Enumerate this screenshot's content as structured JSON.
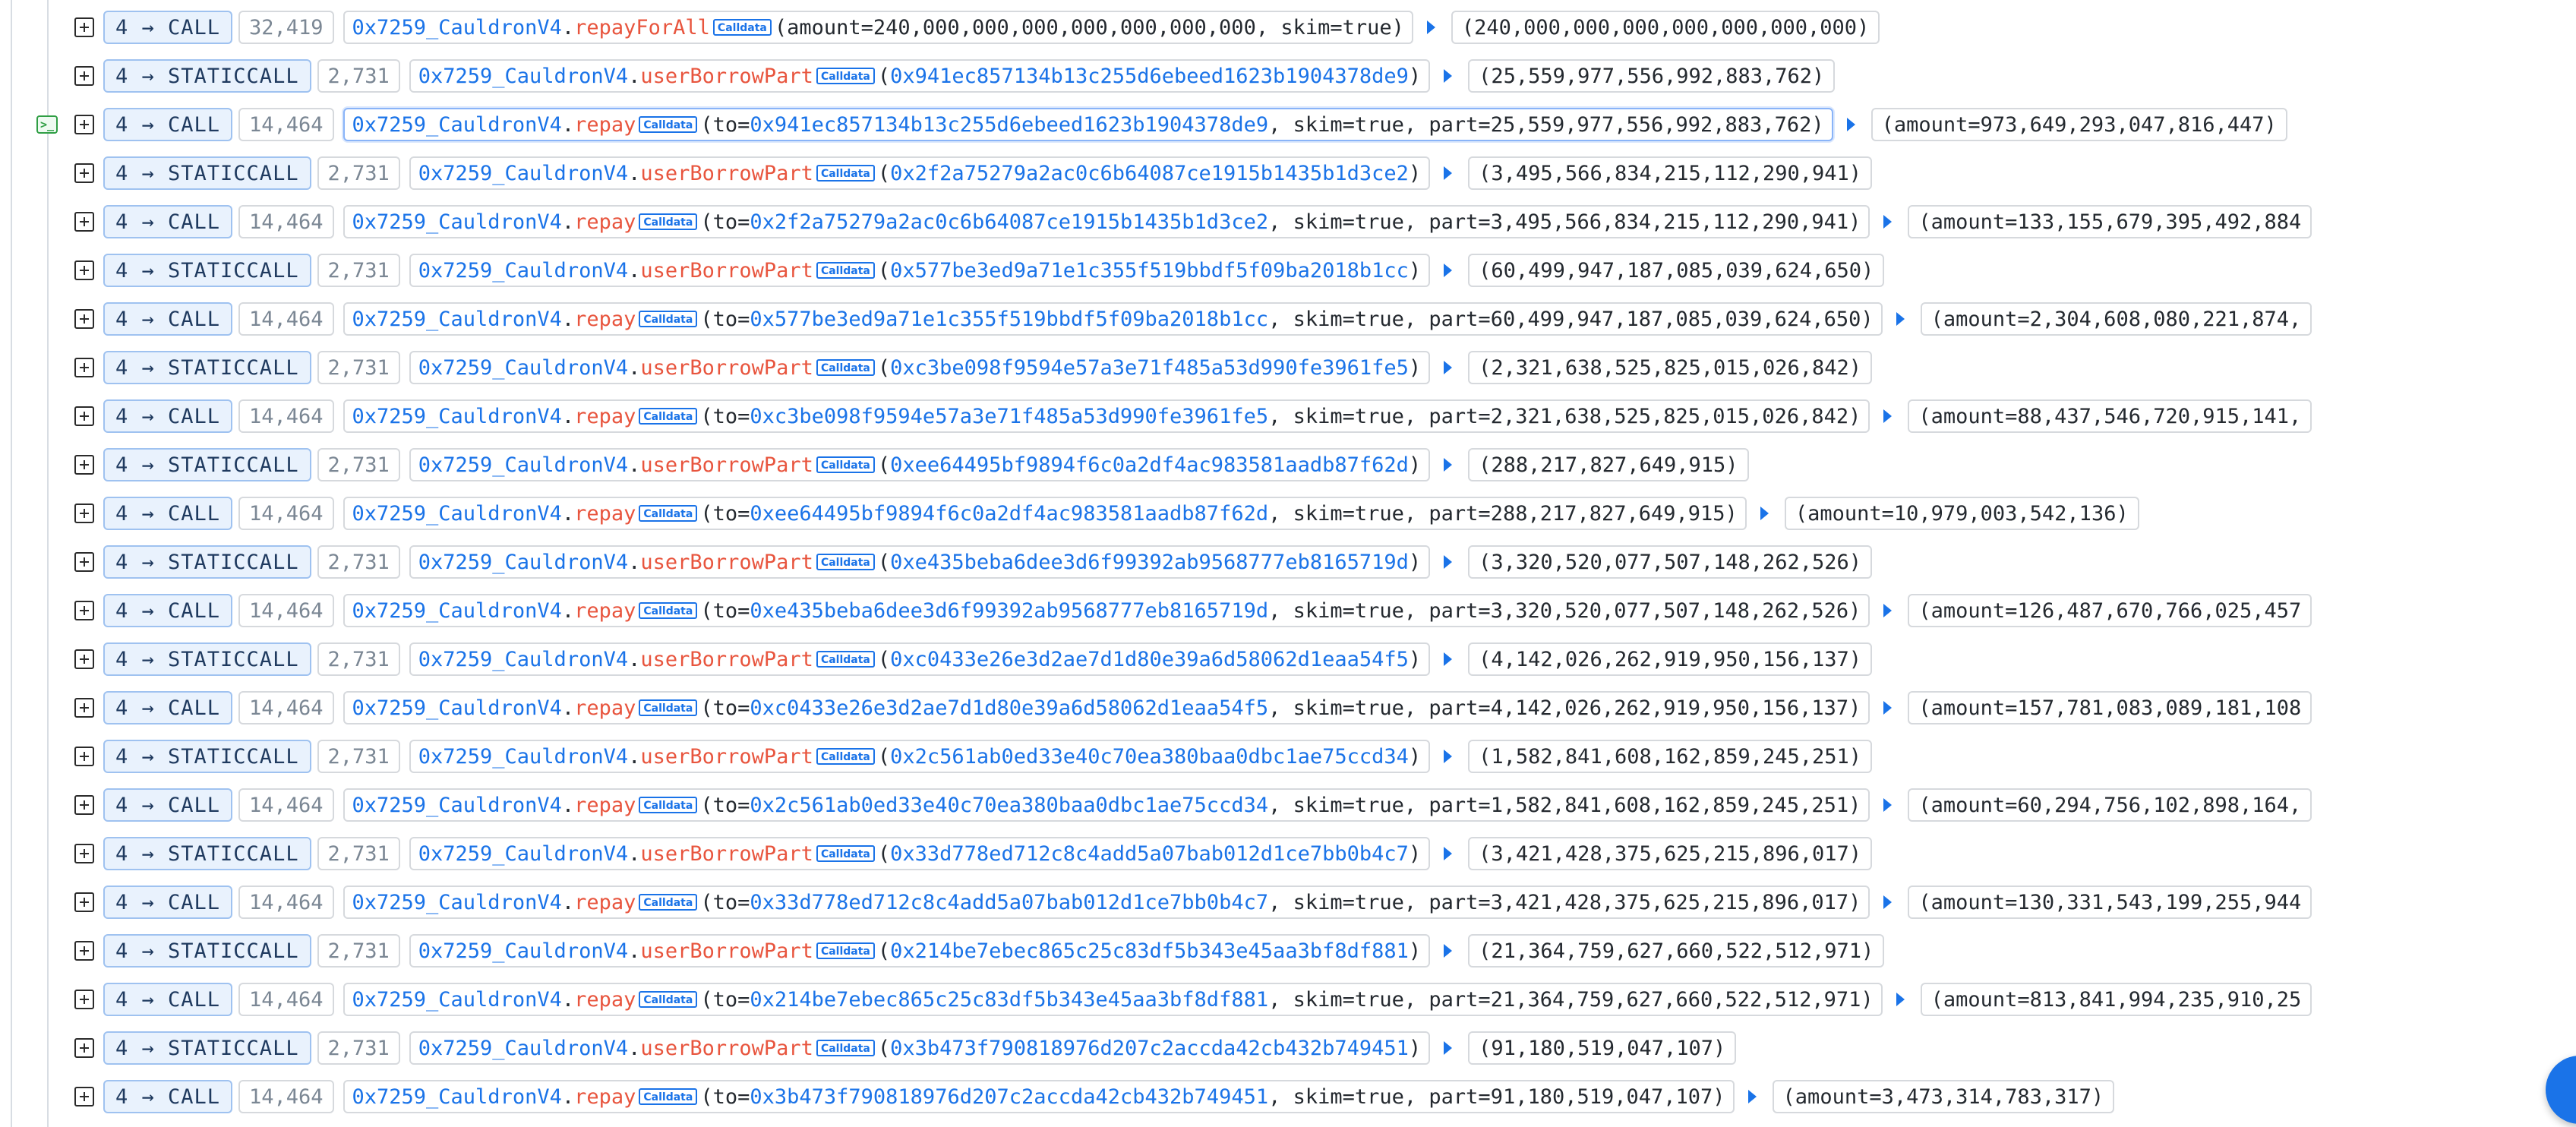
{
  "rows": [
    {
      "depth": "4",
      "type": "CALL",
      "gas": "32,419",
      "contract": "0x7259_CauldronV4",
      "method": "repayForAll",
      "badge": "Calldata",
      "args_pre": "(amount=240,000,000,000,000,000,000,000, skim=true)",
      "addr": "",
      "args_post": "",
      "ret": "(240,000,000,000,000,000,000,000)"
    },
    {
      "depth": "4",
      "type": "STATICCALL",
      "gas": "2,731",
      "contract": "0x7259_CauldronV4",
      "method": "userBorrowPart",
      "badge": "Calldata",
      "args_pre": "(",
      "addr": "0x941ec857134b13c255d6ebeed1623b1904378de9",
      "args_post": ")",
      "ret": "(25,559,977,556,992,883,762)"
    },
    {
      "depth": "4",
      "type": "CALL",
      "gas": "14,464",
      "contract": "0x7259_CauldronV4",
      "method": "repay",
      "badge": "Calldata",
      "args_pre": "(to=",
      "addr": "0x941ec857134b13c255d6ebeed1623b1904378de9",
      "args_post": ", skim=true, part=25,559,977,556,992,883,762)",
      "ret": "(amount=973,649,293,047,816,447)",
      "selected": true
    },
    {
      "depth": "4",
      "type": "STATICCALL",
      "gas": "2,731",
      "contract": "0x7259_CauldronV4",
      "method": "userBorrowPart",
      "badge": "Calldata",
      "args_pre": "(",
      "addr": "0x2f2a75279a2ac0c6b64087ce1915b1435b1d3ce2",
      "args_post": ")",
      "ret": "(3,495,566,834,215,112,290,941)"
    },
    {
      "depth": "4",
      "type": "CALL",
      "gas": "14,464",
      "contract": "0x7259_CauldronV4",
      "method": "repay",
      "badge": "Calldata",
      "args_pre": "(to=",
      "addr": "0x2f2a75279a2ac0c6b64087ce1915b1435b1d3ce2",
      "args_post": ", skim=true, part=3,495,566,834,215,112,290,941)",
      "ret": "(amount=133,155,679,395,492,884"
    },
    {
      "depth": "4",
      "type": "STATICCALL",
      "gas": "2,731",
      "contract": "0x7259_CauldronV4",
      "method": "userBorrowPart",
      "badge": "Calldata",
      "args_pre": "(",
      "addr": "0x577be3ed9a71e1c355f519bbdf5f09ba2018b1cc",
      "args_post": ")",
      "ret": "(60,499,947,187,085,039,624,650)"
    },
    {
      "depth": "4",
      "type": "CALL",
      "gas": "14,464",
      "contract": "0x7259_CauldronV4",
      "method": "repay",
      "badge": "Calldata",
      "args_pre": "(to=",
      "addr": "0x577be3ed9a71e1c355f519bbdf5f09ba2018b1cc",
      "args_post": ", skim=true, part=60,499,947,187,085,039,624,650)",
      "ret": "(amount=2,304,608,080,221,874,"
    },
    {
      "depth": "4",
      "type": "STATICCALL",
      "gas": "2,731",
      "contract": "0x7259_CauldronV4",
      "method": "userBorrowPart",
      "badge": "Calldata",
      "args_pre": "(",
      "addr": "0xc3be098f9594e57a3e71f485a53d990fe3961fe5",
      "args_post": ")",
      "ret": "(2,321,638,525,825,015,026,842)"
    },
    {
      "depth": "4",
      "type": "CALL",
      "gas": "14,464",
      "contract": "0x7259_CauldronV4",
      "method": "repay",
      "badge": "Calldata",
      "args_pre": "(to=",
      "addr": "0xc3be098f9594e57a3e71f485a53d990fe3961fe5",
      "args_post": ", skim=true, part=2,321,638,525,825,015,026,842)",
      "ret": "(amount=88,437,546,720,915,141,"
    },
    {
      "depth": "4",
      "type": "STATICCALL",
      "gas": "2,731",
      "contract": "0x7259_CauldronV4",
      "method": "userBorrowPart",
      "badge": "Calldata",
      "args_pre": "(",
      "addr": "0xee64495bf9894f6c0a2df4ac983581aadb87f62d",
      "args_post": ")",
      "ret": "(288,217,827,649,915)"
    },
    {
      "depth": "4",
      "type": "CALL",
      "gas": "14,464",
      "contract": "0x7259_CauldronV4",
      "method": "repay",
      "badge": "Calldata",
      "args_pre": "(to=",
      "addr": "0xee64495bf9894f6c0a2df4ac983581aadb87f62d",
      "args_post": ", skim=true, part=288,217,827,649,915)",
      "ret": "(amount=10,979,003,542,136)"
    },
    {
      "depth": "4",
      "type": "STATICCALL",
      "gas": "2,731",
      "contract": "0x7259_CauldronV4",
      "method": "userBorrowPart",
      "badge": "Calldata",
      "args_pre": "(",
      "addr": "0xe435beba6dee3d6f99392ab9568777eb8165719d",
      "args_post": ")",
      "ret": "(3,320,520,077,507,148,262,526)"
    },
    {
      "depth": "4",
      "type": "CALL",
      "gas": "14,464",
      "contract": "0x7259_CauldronV4",
      "method": "repay",
      "badge": "Calldata",
      "args_pre": "(to=",
      "addr": "0xe435beba6dee3d6f99392ab9568777eb8165719d",
      "args_post": ", skim=true, part=3,320,520,077,507,148,262,526)",
      "ret": "(amount=126,487,670,766,025,457"
    },
    {
      "depth": "4",
      "type": "STATICCALL",
      "gas": "2,731",
      "contract": "0x7259_CauldronV4",
      "method": "userBorrowPart",
      "badge": "Calldata",
      "args_pre": "(",
      "addr": "0xc0433e26e3d2ae7d1d80e39a6d58062d1eaa54f5",
      "args_post": ")",
      "ret": "(4,142,026,262,919,950,156,137)"
    },
    {
      "depth": "4",
      "type": "CALL",
      "gas": "14,464",
      "contract": "0x7259_CauldronV4",
      "method": "repay",
      "badge": "Calldata",
      "args_pre": "(to=",
      "addr": "0xc0433e26e3d2ae7d1d80e39a6d58062d1eaa54f5",
      "args_post": ", skim=true, part=4,142,026,262,919,950,156,137)",
      "ret": "(amount=157,781,083,089,181,108"
    },
    {
      "depth": "4",
      "type": "STATICCALL",
      "gas": "2,731",
      "contract": "0x7259_CauldronV4",
      "method": "userBorrowPart",
      "badge": "Calldata",
      "args_pre": "(",
      "addr": "0x2c561ab0ed33e40c70ea380baa0dbc1ae75ccd34",
      "args_post": ")",
      "ret": "(1,582,841,608,162,859,245,251)"
    },
    {
      "depth": "4",
      "type": "CALL",
      "gas": "14,464",
      "contract": "0x7259_CauldronV4",
      "method": "repay",
      "badge": "Calldata",
      "args_pre": "(to=",
      "addr": "0x2c561ab0ed33e40c70ea380baa0dbc1ae75ccd34",
      "args_post": ", skim=true, part=1,582,841,608,162,859,245,251)",
      "ret": "(amount=60,294,756,102,898,164,"
    },
    {
      "depth": "4",
      "type": "STATICCALL",
      "gas": "2,731",
      "contract": "0x7259_CauldronV4",
      "method": "userBorrowPart",
      "badge": "Calldata",
      "args_pre": "(",
      "addr": "0x33d778ed712c8c4add5a07bab012d1ce7bb0b4c7",
      "args_post": ")",
      "ret": "(3,421,428,375,625,215,896,017)"
    },
    {
      "depth": "4",
      "type": "CALL",
      "gas": "14,464",
      "contract": "0x7259_CauldronV4",
      "method": "repay",
      "badge": "Calldata",
      "args_pre": "(to=",
      "addr": "0x33d778ed712c8c4add5a07bab012d1ce7bb0b4c7",
      "args_post": ", skim=true, part=3,421,428,375,625,215,896,017)",
      "ret": "(amount=130,331,543,199,255,944"
    },
    {
      "depth": "4",
      "type": "STATICCALL",
      "gas": "2,731",
      "contract": "0x7259_CauldronV4",
      "method": "userBorrowPart",
      "badge": "Calldata",
      "args_pre": "(",
      "addr": "0x214be7ebec865c25c83df5b343e45aa3bf8df881",
      "args_post": ")",
      "ret": "(21,364,759,627,660,522,512,971)"
    },
    {
      "depth": "4",
      "type": "CALL",
      "gas": "14,464",
      "contract": "0x7259_CauldronV4",
      "method": "repay",
      "badge": "Calldata",
      "args_pre": "(to=",
      "addr": "0x214be7ebec865c25c83df5b343e45aa3bf8df881",
      "args_post": ", skim=true, part=21,364,759,627,660,522,512,971)",
      "ret": "(amount=813,841,994,235,910,25"
    },
    {
      "depth": "4",
      "type": "STATICCALL",
      "gas": "2,731",
      "contract": "0x7259_CauldronV4",
      "method": "userBorrowPart",
      "badge": "Calldata",
      "args_pre": "(",
      "addr": "0x3b473f790818976d207c2accda42cb432b749451",
      "args_post": ")",
      "ret": "(91,180,519,047,107)"
    },
    {
      "depth": "4",
      "type": "CALL",
      "gas": "14,464",
      "contract": "0x7259_CauldronV4",
      "method": "repay",
      "badge": "Calldata",
      "args_pre": "(to=",
      "addr": "0x3b473f790818976d207c2accda42cb432b749451",
      "args_post": ", skim=true, part=91,180,519,047,107)",
      "ret": "(amount=3,473,314,783,317)"
    }
  ],
  "icons": {
    "terminal": ">_",
    "expand": "plus-square-icon",
    "arrow": "play-arrow-icon",
    "fab": "floating-action-button"
  },
  "colors": {
    "contract": "#1a73e8",
    "method": "#e8553e",
    "calltype_bg": "#e9f2fd",
    "gas": "#7b8794"
  }
}
